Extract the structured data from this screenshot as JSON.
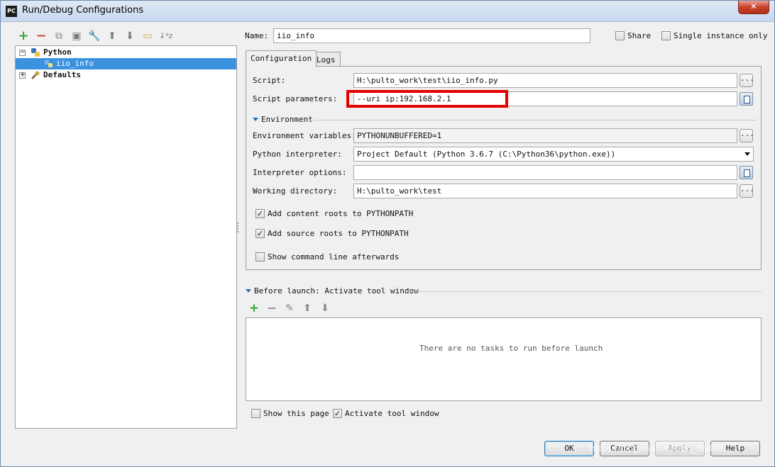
{
  "window": {
    "title": "Run/Debug Configurations",
    "app_icon_label": "PC",
    "close_label": "✕"
  },
  "toolbar": {
    "icons": [
      "add-icon",
      "remove-icon",
      "copy-icon",
      "save-icon",
      "edit-defaults-icon",
      "move-up-icon",
      "move-down-icon",
      "folder-icon",
      "sort-icon"
    ]
  },
  "tree": {
    "python_label": "Python",
    "selected_label": "iio_info",
    "defaults_label": "Defaults"
  },
  "header": {
    "name_label": "Name:",
    "name_value": "iio_info",
    "share_label": "Share",
    "share_checked": false,
    "single_instance_label": "Single instance only",
    "single_instance_checked": false
  },
  "tabs": [
    "Configuration",
    "Logs"
  ],
  "config": {
    "script_label": "Script:",
    "script_value": "H:\\pulto_work\\test\\iio_info.py",
    "script_params_label": "Script parameters:",
    "script_params_value": "--uri ip:192.168.2.1",
    "environment_label": "Environment",
    "env_vars_label": "Environment variables:",
    "env_vars_value": "PYTHONUNBUFFERED=1",
    "interpreter_label": "Python interpreter:",
    "interpreter_value": "Project Default (Python 3.6.7 (C:\\Python36\\python.exe))",
    "interpreter_options_label": "Interpreter options:",
    "interpreter_options_value": "",
    "working_dir_label": "Working directory:",
    "working_dir_value": "H:\\pulto_work\\test",
    "content_roots_label": "Add content roots to PYTHONPATH",
    "content_roots_checked": true,
    "source_roots_label": "Add source roots to PYTHONPATH",
    "source_roots_checked": true,
    "show_cmd_label": "Show command line afterwards",
    "show_cmd_checked": false,
    "browse_label": "..."
  },
  "before_launch": {
    "title": "Before launch: Activate tool window",
    "empty_text": "There are no tasks to run before launch",
    "show_page_label": "Show this page",
    "show_page_checked": false,
    "activate_label": "Activate tool window",
    "activate_checked": true
  },
  "buttons": {
    "ok": "OK",
    "cancel": "Cancel",
    "apply": "Apply",
    "help": "Help"
  },
  "watermark": "https://blog.csdn.net/qq_38408..."
}
